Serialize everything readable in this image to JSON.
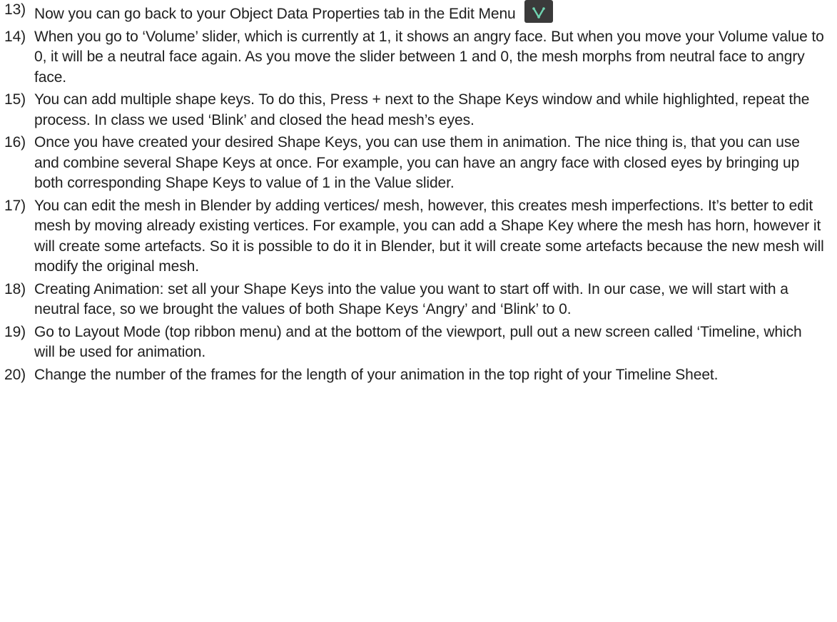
{
  "document": {
    "steps": [
      {
        "number": "13)",
        "text": "Now you can go back to your Object Data Properties tab in the Edit Menu",
        "icon": "object-data-properties-icon"
      },
      {
        "number": "14)",
        "text": "When you go to ‘Volume’ slider, which is currently at 1, it shows an angry face. But when you move your Volume value to 0, it will be a neutral face again. As you move the slider between 1 and 0, the mesh morphs from neutral face to angry face."
      },
      {
        "number": "15)",
        "text": "You can add multiple shape keys. To do this, Press + next to the Shape Keys window and while highlighted, repeat the process. In class we used ‘Blink’ and closed the head mesh’s eyes."
      },
      {
        "number": "16)",
        "text": "Once you have created your desired Shape Keys, you can use them in animation. The nice thing is, that you can use and combine several Shape Keys at once. For example, you can have an angry face with closed eyes by bringing up both corresponding Shape Keys to value of 1 in the Value slider."
      },
      {
        "number": "17)",
        "text": "You can edit the mesh in Blender by adding vertices/ mesh, however, this creates mesh imperfections. It’s better to edit mesh by moving already existing vertices. For example, you can add a Shape Key where the mesh has horn, however it will create some artefacts. So it is possible to do it in Blender, but it will create some artefacts because the new mesh will modify the original mesh."
      },
      {
        "number": "18)",
        "text": "Creating Animation: set all your Shape Keys into the value you want to start off with. In our case, we will start with a neutral face, so we brought the values of both Shape Keys ‘Angry’ and ‘Blink’ to 0."
      },
      {
        "number": "19)",
        "text": "Go to Layout Mode (top ribbon menu) and at the bottom of the viewport, pull out a new screen called ‘Timeline, which will be used for animation."
      },
      {
        "number": "20)",
        "text": "Change the number of the frames for the length of your animation in the top right of your Timeline Sheet."
      }
    ]
  }
}
